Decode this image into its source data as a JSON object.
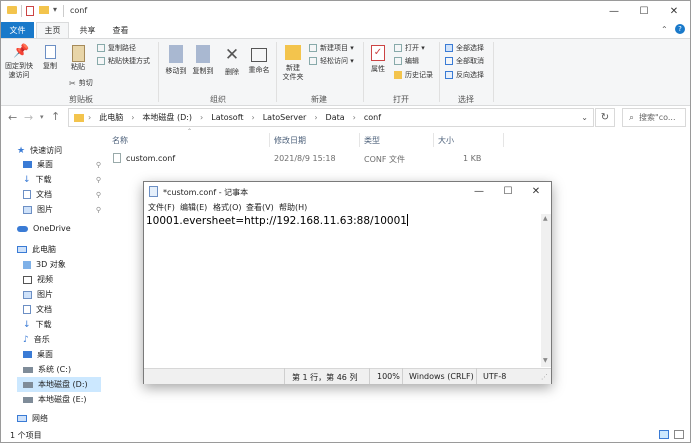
{
  "window": {
    "title": "conf",
    "minimize": "—",
    "maximize": "☐",
    "close": "✕"
  },
  "ribbon": {
    "tabs": [
      "文件",
      "主页",
      "共享",
      "查看"
    ],
    "clipboard": {
      "pin": "固定到快\n速访问",
      "copy": "复制",
      "paste": "粘贴",
      "copy_path": "复制路径",
      "paste_shortcut": "粘贴快捷方式",
      "cut": "剪切",
      "group": "剪贴板"
    },
    "organize": {
      "move_to": "移动到",
      "copy_to": "复制到",
      "delete": "删除",
      "rename": "重命名",
      "group": "组织"
    },
    "new": {
      "new_folder": "新建\n文件夹",
      "new_item": "新建项目 ▾",
      "easy_access": "轻松访问 ▾",
      "group": "新建"
    },
    "open": {
      "properties": "属性",
      "open": "打开 ▾",
      "edit": "编辑",
      "history": "历史记录",
      "group": "打开"
    },
    "select": {
      "select_all": "全部选择",
      "select_none": "全部取消",
      "invert": "反向选择",
      "group": "选择"
    }
  },
  "address": {
    "crumbs": [
      "此电脑",
      "本地磁盘 (D:)",
      "Latosoft",
      "LatoServer",
      "Data",
      "conf"
    ],
    "search_placeholder": "搜索\"co..."
  },
  "sidebar": {
    "quick_access": "快速访问",
    "items": [
      {
        "label": "桌面",
        "pinned": true
      },
      {
        "label": "下载",
        "pinned": true
      },
      {
        "label": "文档",
        "pinned": true
      },
      {
        "label": "图片",
        "pinned": true
      }
    ],
    "onedrive": "OneDrive",
    "this_pc": "此电脑",
    "pc_items": [
      "3D 对象",
      "视频",
      "图片",
      "文档",
      "下载",
      "音乐",
      "桌面",
      "系统 (C:)",
      "本地磁盘 (D:)",
      "本地磁盘 (E:)"
    ],
    "network": "网络"
  },
  "files": {
    "headers": [
      "名称",
      "修改日期",
      "类型",
      "大小"
    ],
    "rows": [
      {
        "name": "custom.conf",
        "date": "2021/8/9 15:18",
        "type": "CONF 文件",
        "size": "1 KB"
      }
    ]
  },
  "status": {
    "count": "1 个项目"
  },
  "notepad": {
    "title": "*custom.conf - 记事本",
    "menu": [
      "文件(F)",
      "编辑(E)",
      "格式(O)",
      "查看(V)",
      "帮助(H)"
    ],
    "content": "10001.eversheet=http://192.168.11.63:88/10001",
    "status": {
      "position": "第 1 行，第 46 列",
      "zoom": "100%",
      "line_ending": "Windows (CRLF)",
      "encoding": "UTF-8"
    }
  },
  "colors": {
    "accent": "#1979ca",
    "folder": "#f3c44d",
    "selection": "#cce8ff"
  }
}
